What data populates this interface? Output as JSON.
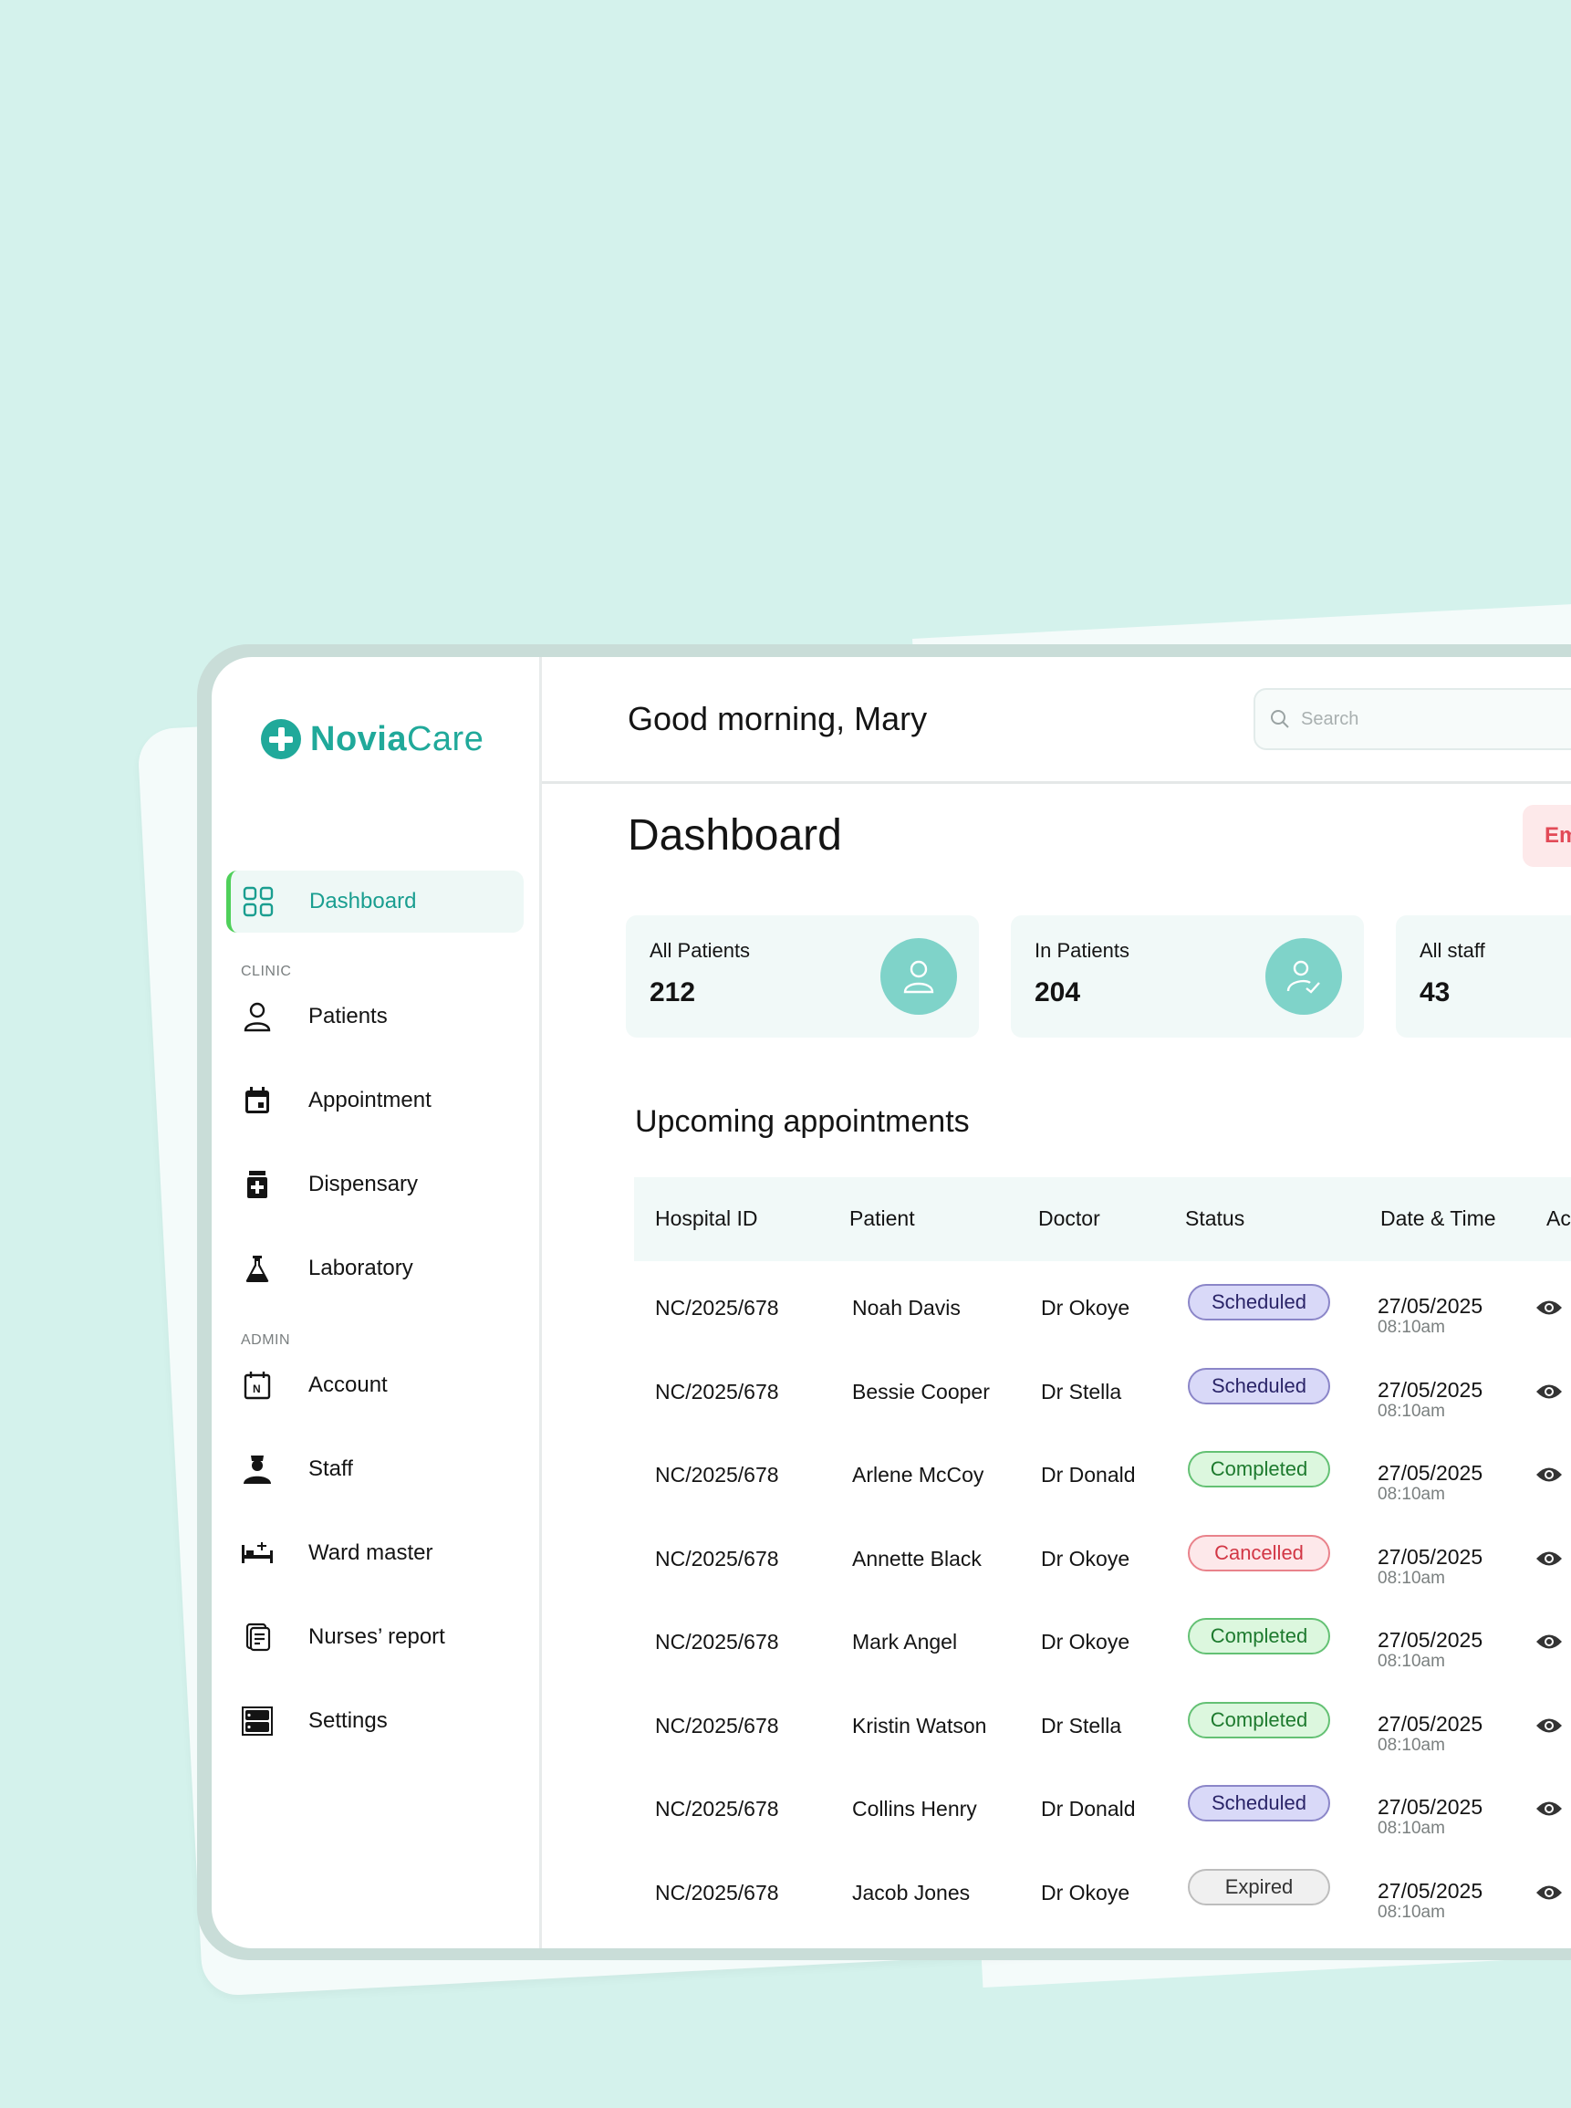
{
  "app": {
    "logo_bold": "Novia",
    "logo_light": "Care",
    "accent_color": "#20a99a"
  },
  "sidebar": {
    "active": {
      "label": "Dashboard",
      "icon": "grid-icon"
    },
    "sections": [
      {
        "title": "CLINIC",
        "items": [
          {
            "label": "Patients",
            "icon": "user-icon"
          },
          {
            "label": "Appointment",
            "icon": "calendar-icon"
          },
          {
            "label": "Dispensary",
            "icon": "medicine-icon"
          },
          {
            "label": "Laboratory",
            "icon": "flask-icon"
          }
        ]
      },
      {
        "title": "ADMIN",
        "items": [
          {
            "label": "Account",
            "icon": "account-calendar-icon"
          },
          {
            "label": "Staff",
            "icon": "nurse-icon"
          },
          {
            "label": "Ward master",
            "icon": "bed-icon"
          },
          {
            "label": "Nurses’ report",
            "icon": "report-icon"
          },
          {
            "label": "Settings",
            "icon": "server-icon"
          }
        ]
      }
    ]
  },
  "header": {
    "greeting": "Good morning, Mary",
    "search_placeholder": "Search"
  },
  "main": {
    "title": "Dashboard",
    "emergency_label": "Em",
    "stats": [
      {
        "label": "All Patients",
        "value": "212",
        "icon": "user-icon"
      },
      {
        "label": "In Patients",
        "value": "204",
        "icon": "user-check-icon"
      },
      {
        "label": "All staff",
        "value": "43"
      }
    ],
    "appointments": {
      "title": "Upcoming appointments",
      "columns": [
        "Hospital ID",
        "Patient",
        "Doctor",
        "Status",
        "Date & Time",
        "Ac"
      ],
      "rows": [
        {
          "id": "NC/2025/678",
          "patient": "Noah Davis",
          "doctor": "Dr Okoye",
          "status": "Scheduled",
          "date": "27/05/2025",
          "time": "08:10am"
        },
        {
          "id": "NC/2025/678",
          "patient": "Bessie Cooper",
          "doctor": "Dr Stella",
          "status": "Scheduled",
          "date": "27/05/2025",
          "time": "08:10am"
        },
        {
          "id": "NC/2025/678",
          "patient": "Arlene McCoy",
          "doctor": "Dr Donald",
          "status": "Completed",
          "date": "27/05/2025",
          "time": "08:10am"
        },
        {
          "id": "NC/2025/678",
          "patient": "Annette Black",
          "doctor": "Dr Okoye",
          "status": "Cancelled",
          "date": "27/05/2025",
          "time": "08:10am"
        },
        {
          "id": "NC/2025/678",
          "patient": "Mark Angel",
          "doctor": "Dr Okoye",
          "status": "Completed",
          "date": "27/05/2025",
          "time": "08:10am"
        },
        {
          "id": "NC/2025/678",
          "patient": "Kristin Watson",
          "doctor": "Dr Stella",
          "status": "Completed",
          "date": "27/05/2025",
          "time": "08:10am"
        },
        {
          "id": "NC/2025/678",
          "patient": "Collins Henry",
          "doctor": "Dr Donald",
          "status": "Scheduled",
          "date": "27/05/2025",
          "time": "08:10am"
        },
        {
          "id": "NC/2025/678",
          "patient": "Jacob Jones",
          "doctor": "Dr Okoye",
          "status": "Expired",
          "date": "27/05/2025",
          "time": "08:10am"
        }
      ]
    }
  }
}
